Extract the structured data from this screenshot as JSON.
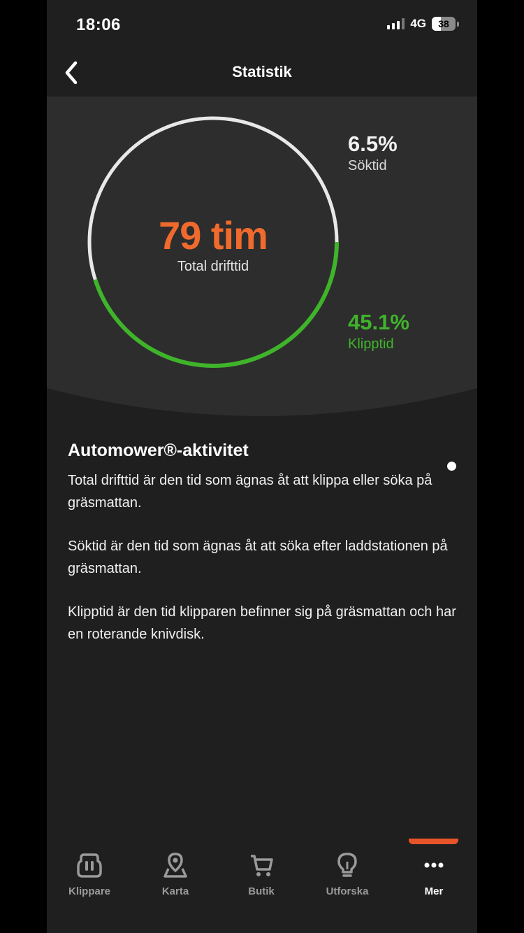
{
  "status_bar": {
    "time": "18:06",
    "network": "4G",
    "battery": "38",
    "battery_percent": 38
  },
  "header": {
    "title": "Statistik"
  },
  "stats": {
    "total": {
      "value": "79 tim",
      "label": "Total drifttid"
    },
    "search": {
      "value": "6.5%",
      "label": "Söktid",
      "percent": 6.5
    },
    "cut": {
      "value": "45.1%",
      "label": "Klipptid",
      "percent": 45.1
    }
  },
  "colors": {
    "accent": "#f06a2d",
    "green": "#3fb42b",
    "ring": "#e8e8e8",
    "tab_indicator": "#e8542a"
  },
  "info": {
    "heading": "Automower®-aktivitet",
    "paragraphs": [
      "Total drifttid är den tid som ägnas åt att klippa eller söka på gräsmattan.",
      "Söktid är den tid som ägnas åt att söka efter laddstationen på gräsmattan.",
      "Klipptid är den tid klipparen befinner sig på gräsmattan och har en roterande knivdisk."
    ]
  },
  "tabs": [
    {
      "label": "Klippare",
      "icon": "mower-icon"
    },
    {
      "label": "Karta",
      "icon": "map-pin-icon"
    },
    {
      "label": "Butik",
      "icon": "cart-icon"
    },
    {
      "label": "Utforska",
      "icon": "lightbulb-icon"
    },
    {
      "label": "Mer",
      "icon": "more-icon",
      "active": true
    }
  ]
}
